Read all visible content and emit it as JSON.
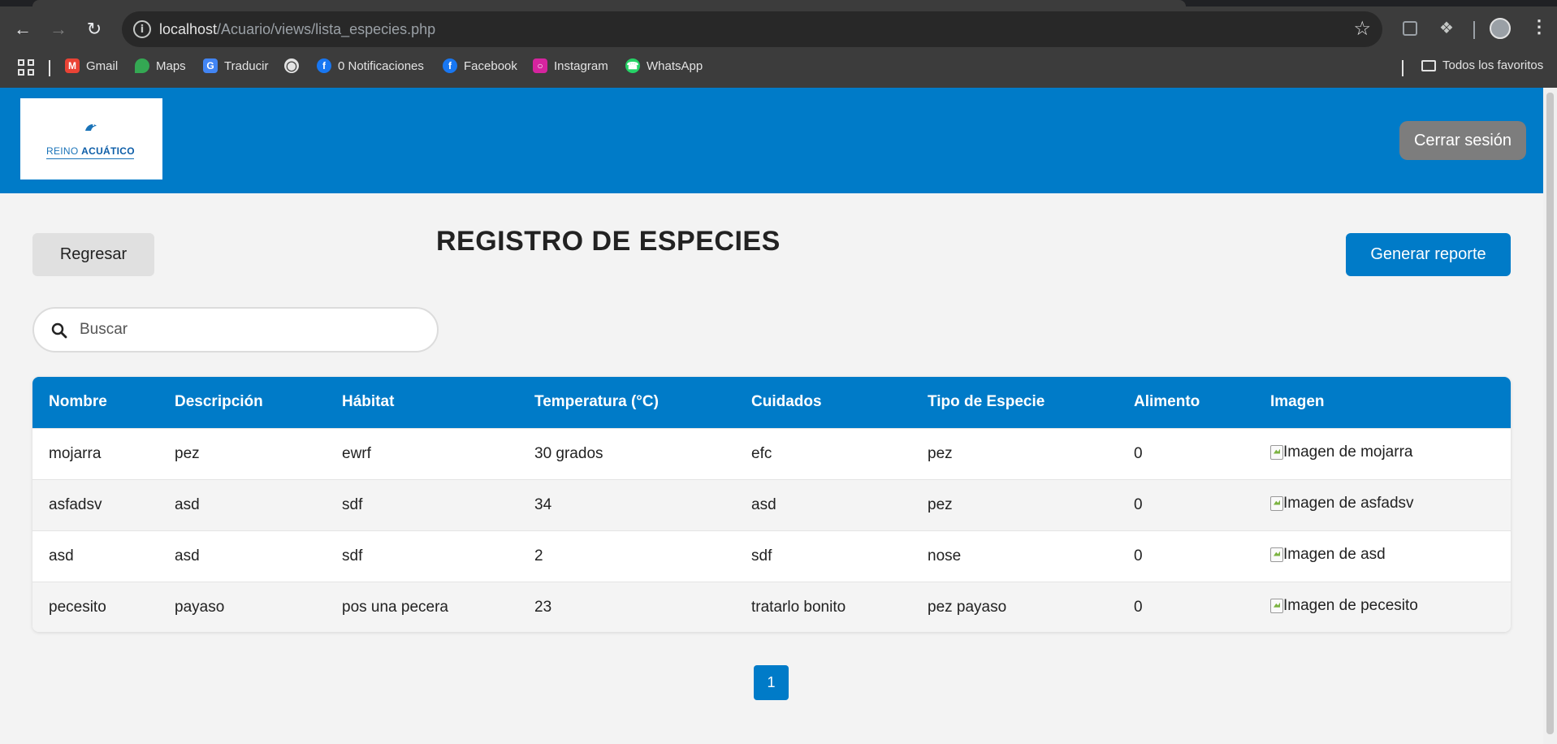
{
  "browser": {
    "url_host": "localhost",
    "url_path": "/Acuario/views/lista_especies.php",
    "bookmarks": [
      {
        "label": "Gmail",
        "icon": "gmail-icon",
        "color": "#ea4335"
      },
      {
        "label": "Maps",
        "icon": "maps-icon",
        "color": "#34a853"
      },
      {
        "label": "Traducir",
        "icon": "translate-icon",
        "color": "#4285f4"
      },
      {
        "label": "",
        "icon": "globe-icon",
        "color": "#e3e3e3"
      },
      {
        "label": "0 Notificaciones",
        "icon": "facebook-icon",
        "color": "#1877f2"
      },
      {
        "label": "Facebook",
        "icon": "facebook-icon",
        "color": "#1877f2"
      },
      {
        "label": "Instagram",
        "icon": "instagram-icon",
        "color": "#d6249f"
      },
      {
        "label": "WhatsApp",
        "icon": "whatsapp-icon",
        "color": "#25d366"
      }
    ],
    "all_bookmarks_label": "Todos los favoritos"
  },
  "header": {
    "logo_text_light": "REINO",
    "logo_text_bold": "ACUÁTICO",
    "logout_label": "Cerrar sesión",
    "accent_color": "#007bc8"
  },
  "toolbar": {
    "back_label": "Regresar",
    "title": "REGISTRO DE ESPECIES",
    "report_label": "Generar reporte"
  },
  "search": {
    "placeholder": "Buscar",
    "value": ""
  },
  "table": {
    "columns": [
      "Nombre",
      "Descripción",
      "Hábitat",
      "Temperatura (°C)",
      "Cuidados",
      "Tipo de Especie",
      "Alimento",
      "Imagen"
    ],
    "rows": [
      [
        "mojarra",
        "pez",
        "ewrf",
        "30 grados",
        "efc",
        "pez",
        "0",
        "Imagen de mojarra"
      ],
      [
        "asfadsv",
        "asd",
        "sdf",
        "34",
        "asd",
        "pez",
        "0",
        "Imagen de asfadsv"
      ],
      [
        "asd",
        "asd",
        "sdf",
        "2",
        "sdf",
        "nose",
        "0",
        "Imagen de asd"
      ],
      [
        "pecesito",
        "payaso",
        "pos una pecera",
        "23",
        "tratarlo bonito",
        "pez payaso",
        "0",
        "Imagen de pecesito"
      ]
    ]
  },
  "pagination": {
    "current_page": "1"
  }
}
